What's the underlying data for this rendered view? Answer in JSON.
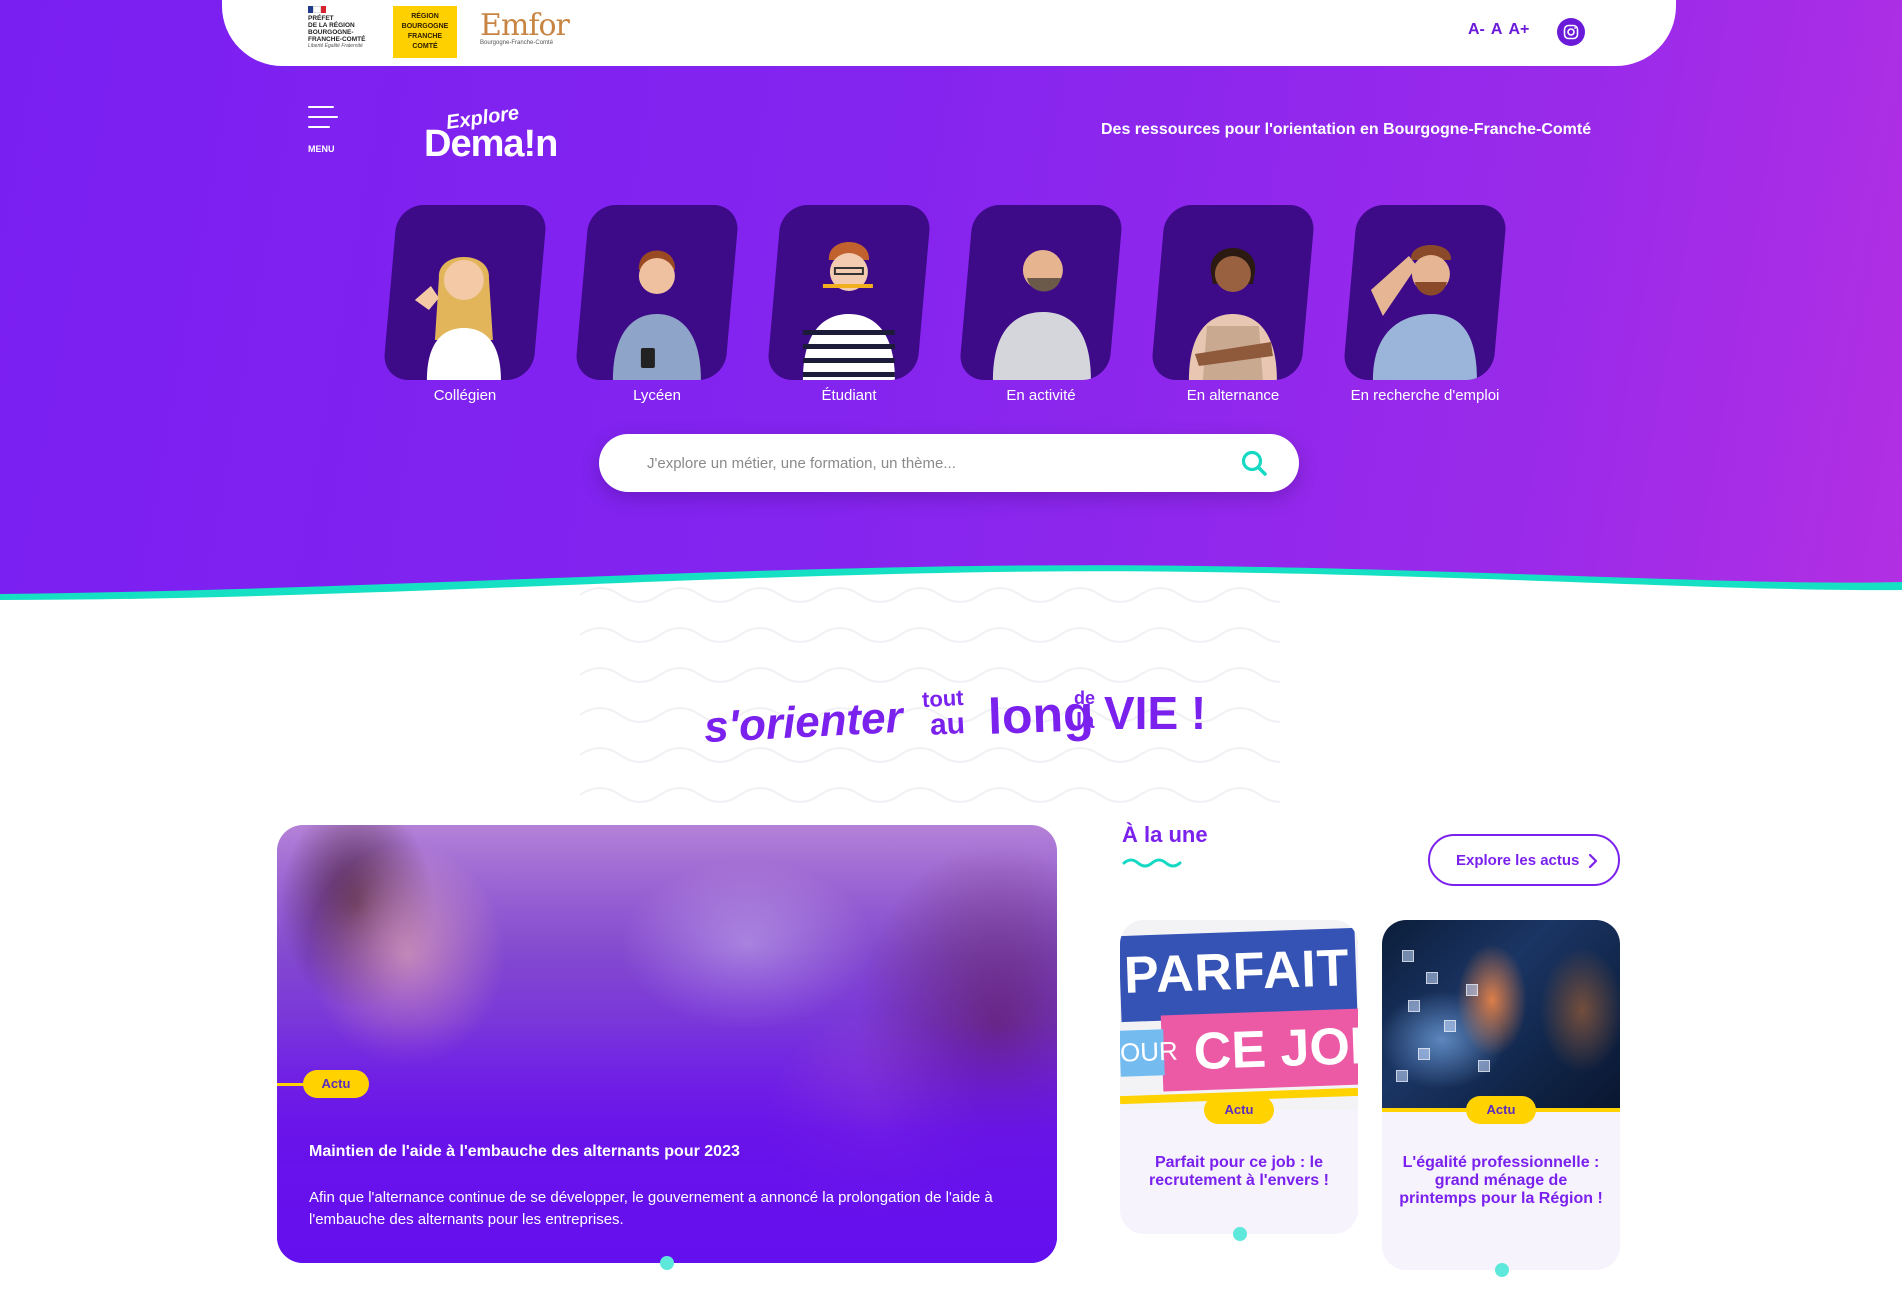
{
  "header": {
    "prefet_logo": {
      "lines": [
        "PRÉFET",
        "DE LA RÉGION",
        "BOURGOGNE-",
        "FRANCHE-COMTÉ"
      ],
      "sub": "Liberté Égalité Fraternité"
    },
    "region_logo": {
      "lines": [
        "RÉGION",
        "BOURGOGNE",
        "FRANCHE",
        "COMTÉ"
      ]
    },
    "emfor_logo": {
      "word": "Emfor",
      "tag": "Bourgogne-Franche-Comté"
    },
    "font_controls": {
      "decrease": "A-",
      "reset": "A",
      "increase": "A+"
    },
    "social_icon": "instagram-icon"
  },
  "nav": {
    "menu_label": "MENU",
    "logo_line1": "Explore",
    "logo_line2": "Dema!n",
    "tagline": "Des ressources pour l'orientation en Bourgogne-Franche-Comté"
  },
  "personas": [
    {
      "label": "Collégien"
    },
    {
      "label": "Lycéen"
    },
    {
      "label": "Étudiant"
    },
    {
      "label": "En activité"
    },
    {
      "label": "En alternance"
    },
    {
      "label": "En recherche d'emploi"
    }
  ],
  "search": {
    "placeholder": "J'explore un métier, une formation, un thème...",
    "value": ""
  },
  "slogan": {
    "w1": "s'orienter",
    "w2a": "tout",
    "w2b": "au",
    "w3": "long",
    "w4a": "de",
    "w4b": "la",
    "w5": "VIE !"
  },
  "featured": {
    "badge": "Actu",
    "title": "Maintien de l'aide à l'embauche des alternants pour 2023",
    "description": "Afin que l'alternance continue de se développer, le gouvernement a annoncé la prolongation de l'aide à l'embauche des alternants pour les entreprises."
  },
  "une": {
    "title": "À la une",
    "button_label": "Explore les actus",
    "cards": [
      {
        "badge": "Actu",
        "title": "Parfait pour ce job : le recrutement à l'envers !",
        "image_text_1": "PARFAIT",
        "image_text_2a": "OUR",
        "image_text_2b": "CE JOB"
      },
      {
        "badge": "Actu",
        "title": "L'égalité professionnelle : grand ménage de printemps pour la Région !"
      }
    ]
  },
  "colors": {
    "primary": "#7b21ee",
    "accent_teal": "#16e0c3",
    "accent_yellow": "#ffd200",
    "hero_dark": "#3d0a88"
  }
}
